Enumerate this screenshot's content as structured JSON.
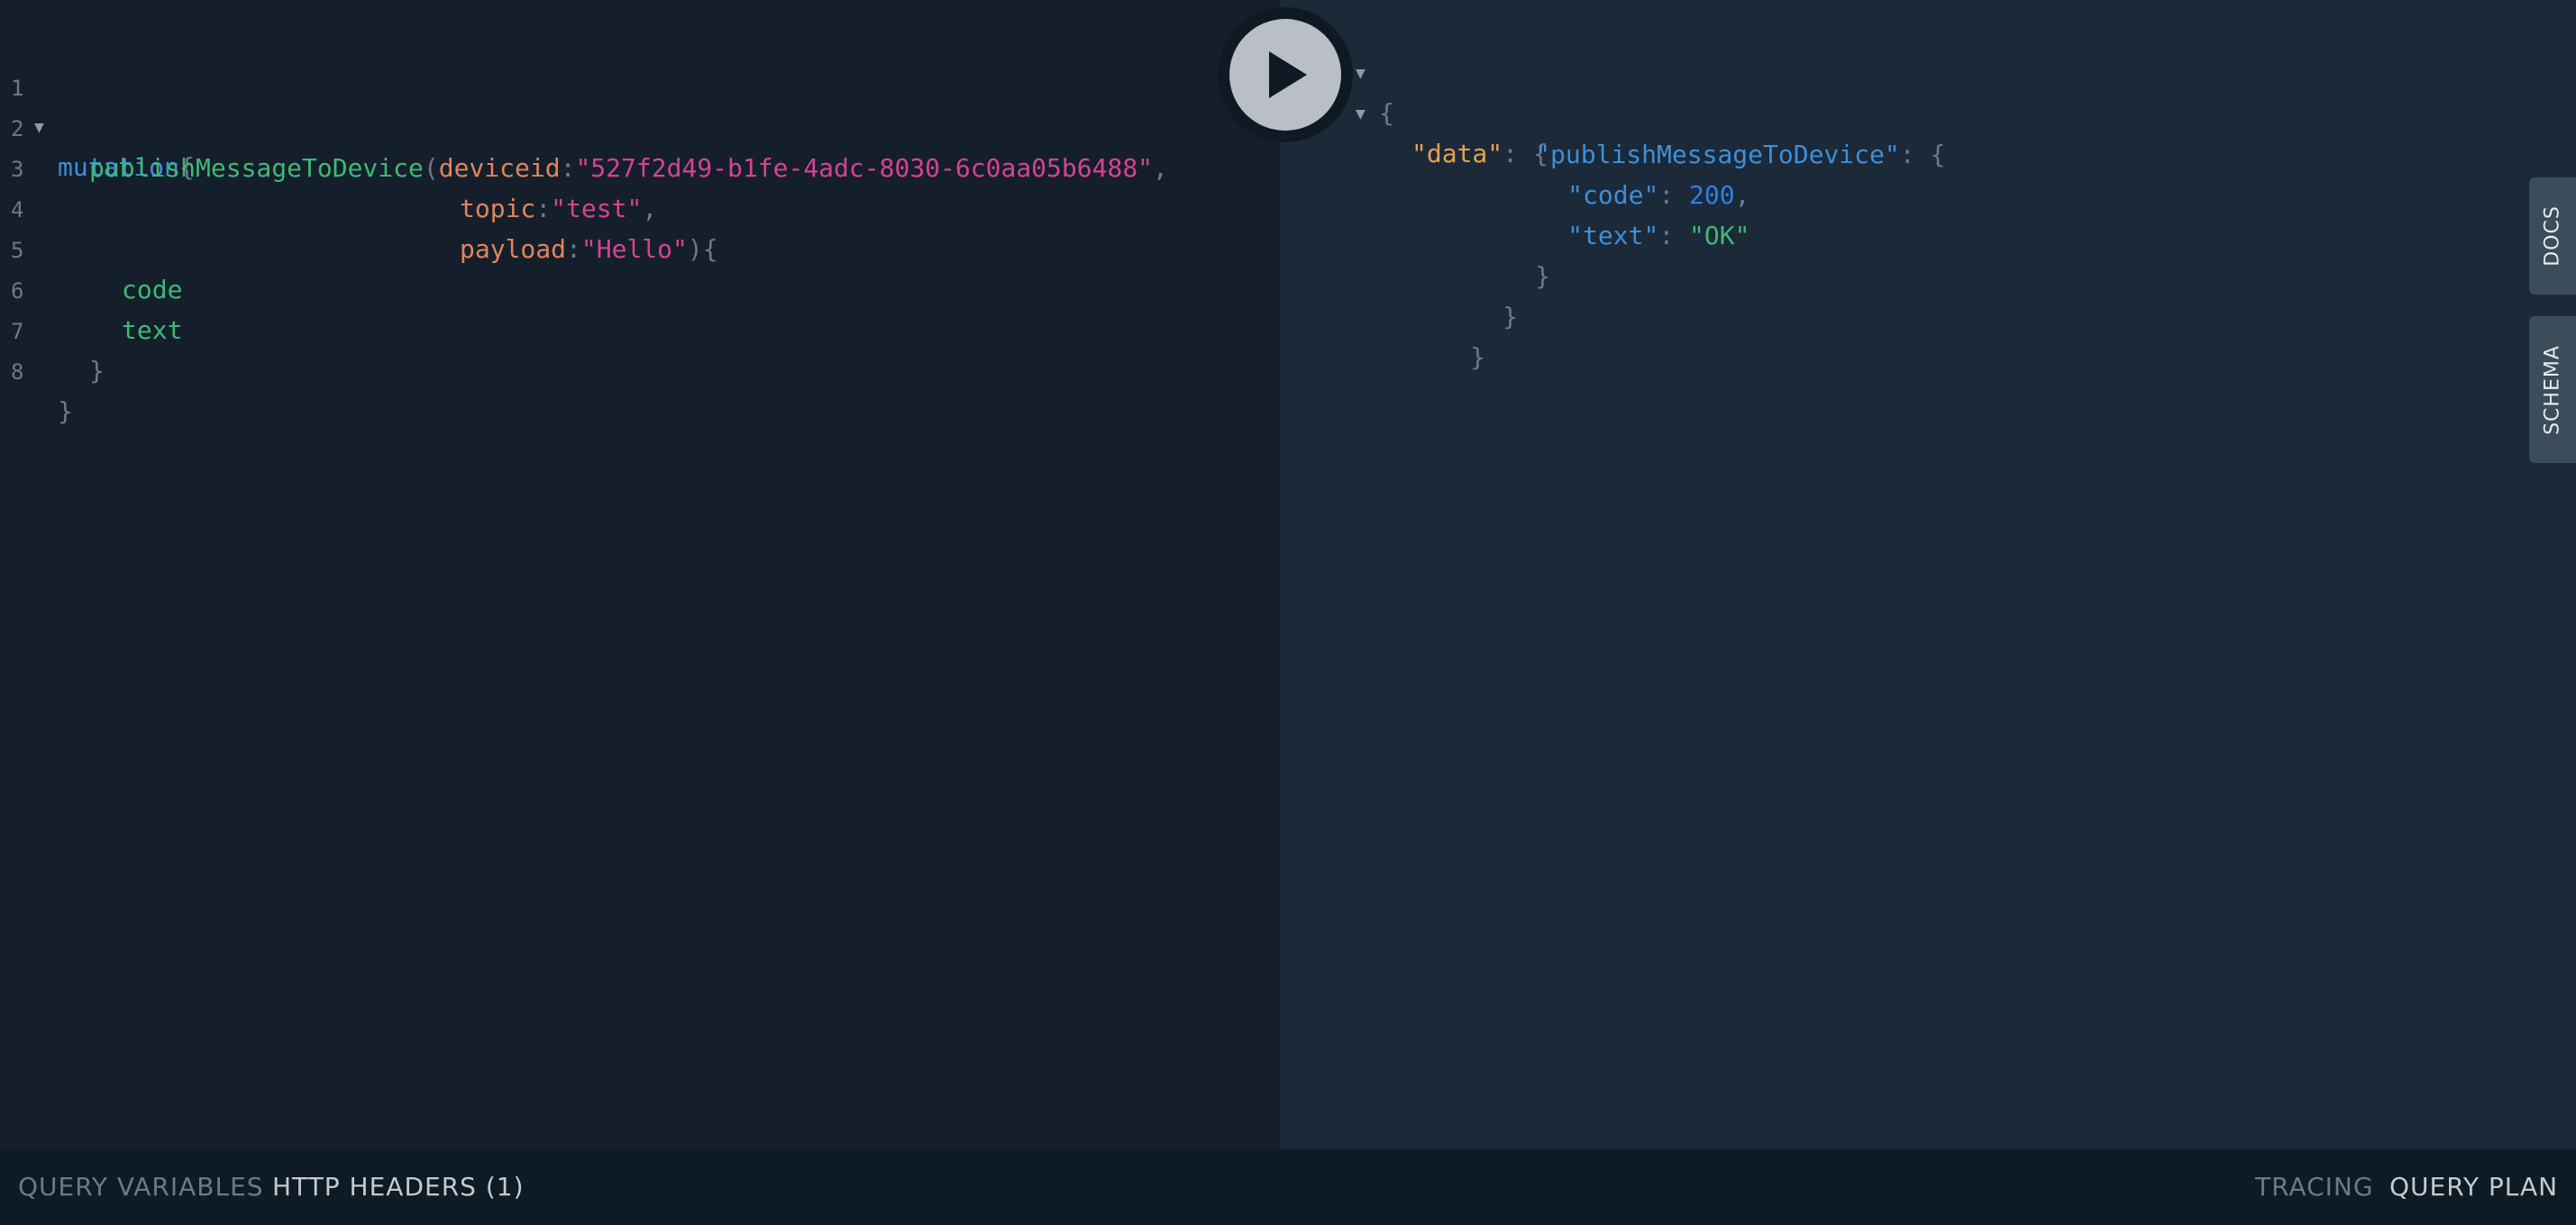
{
  "editor": {
    "lines": [
      {
        "num": "1"
      },
      {
        "num": "2"
      },
      {
        "num": "3"
      },
      {
        "num": "4"
      },
      {
        "num": "5"
      },
      {
        "num": "6"
      },
      {
        "num": "7"
      },
      {
        "num": "8"
      }
    ],
    "tokens": {
      "mutation": "mutation",
      "brace_open": "{",
      "field_name": "publishMessageToDevice",
      "paren_open": "(",
      "arg_deviceid": "deviceid",
      "colon": ":",
      "deviceid_value": "\"527f2d49-b1fe-4adc-8030-6c0aa05b6488\"",
      "comma": ",",
      "arg_topic": "topic",
      "topic_value": "\"test\"",
      "arg_payload": "payload",
      "payload_value": "\"Hello\"",
      "paren_close": ")",
      "field_code": "code",
      "field_text": "text",
      "brace_close": "}"
    }
  },
  "run_button": {
    "icon": "play-icon"
  },
  "result": {
    "open_brace": "{",
    "data_key": "\"data\"",
    "colon_sep": ": ",
    "field_key": "\"publishMessageToDevice\"",
    "code_key": "\"code\"",
    "code_value": "200",
    "comma": ",",
    "text_key": "\"text\"",
    "text_value": "\"OK\"",
    "close_brace": "}"
  },
  "side_tabs": {
    "docs": "DOCS",
    "schema": "SCHEMA"
  },
  "bottom_bar": {
    "query_variables": "QUERY VARIABLES",
    "http_headers": "HTTP HEADERS (1)",
    "tracing": "TRACING",
    "query_plan": "QUERY PLAN"
  },
  "colors": {
    "editor_bg": "#141f2b",
    "result_bg": "#1b2939",
    "keyword": "#3f8ed6",
    "field": "#3fb874",
    "argument": "#e0845d",
    "string": "#d64292",
    "number": "#2f7fe8",
    "json_data_key": "#e8a04b"
  }
}
